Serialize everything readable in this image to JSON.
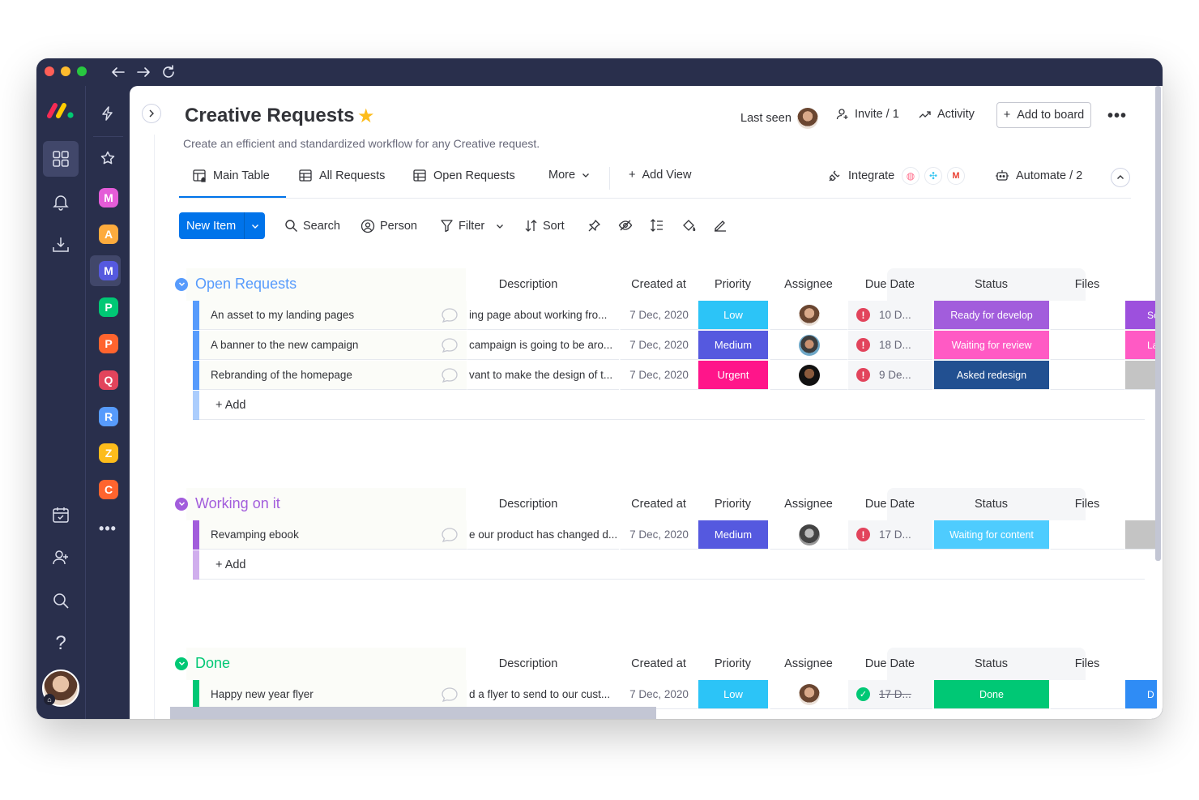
{
  "board": {
    "title": "Creative Requests",
    "subtitle": "Create an efficient and standardized workflow for any Creative request.",
    "last_seen": "Last seen",
    "invite": "Invite / 1",
    "activity": "Activity",
    "add_to_board": "Add to board"
  },
  "tabs": {
    "main_table": "Main Table",
    "all_requests": "All Requests",
    "open_requests": "Open Requests",
    "more": "More",
    "add_view": "Add View",
    "integrate": "Integrate",
    "automate": "Automate / 2"
  },
  "toolbar": {
    "new_item": "New Item",
    "search": "Search",
    "person": "Person",
    "filter": "Filter",
    "sort": "Sort"
  },
  "workspaces": [
    "M",
    "A",
    "M",
    "P",
    "P",
    "Q",
    "R",
    "Z",
    "C"
  ],
  "columns": {
    "description": "Description",
    "created_at": "Created at",
    "priority": "Priority",
    "assignee": "Assignee",
    "due_date": "Due Date",
    "status": "Status",
    "files": "Files"
  },
  "add_label": "+ Add",
  "groups": [
    {
      "title": "Open Requests",
      "color": "#579bfc",
      "rows": [
        {
          "name": "An asset to my landing pages",
          "description": "ing page about working fro...",
          "created": "7 Dec, 2020",
          "priority": "Low",
          "priority_color": "#2cc4f7",
          "due": "10 D...",
          "status": "Ready for develop",
          "status_color": "#a25ddc",
          "extra": "Sc",
          "extra_color": "#9d50dd"
        },
        {
          "name": "A banner to the new campaign",
          "description": "campaign is going to be aro...",
          "created": "7 Dec, 2020",
          "priority": "Medium",
          "priority_color": "#5559df",
          "due": "18 D...",
          "status": "Waiting for review",
          "status_color": "#ff5ac4",
          "extra": "La",
          "extra_color": "#ff5ac4"
        },
        {
          "name": "Rebranding of the homepage",
          "description": "vant to make the design of t...",
          "created": "7 Dec, 2020",
          "priority": "Urgent",
          "priority_color": "#ff158a",
          "due": "9 De...",
          "status": "Asked redesign",
          "status_color": "#225091",
          "extra": "",
          "extra_color": "#c4c4c4"
        }
      ]
    },
    {
      "title": "Working on it",
      "color": "#a25ddc",
      "rows": [
        {
          "name": "Revamping ebook",
          "description": "e our product has changed d...",
          "created": "7 Dec, 2020",
          "priority": "Medium",
          "priority_color": "#5559df",
          "due": "17 D...",
          "status": "Waiting for content",
          "status_color": "#4eccfe",
          "extra": "",
          "extra_color": "#c4c4c4"
        }
      ]
    },
    {
      "title": "Done",
      "color": "#00c875",
      "rows": [
        {
          "name": "Happy new year flyer",
          "description": "d a flyer to send to our cust...",
          "created": "7 Dec, 2020",
          "priority": "Low",
          "priority_color": "#2cc4f7",
          "due": "17 D...",
          "status": "Done",
          "status_color": "#00c875",
          "extra": "D",
          "extra_color": "#2f8cf5"
        }
      ]
    }
  ]
}
